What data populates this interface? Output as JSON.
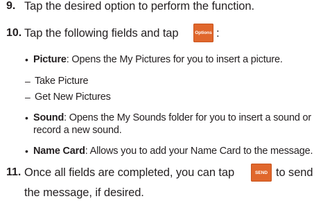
{
  "steps": {
    "s9": {
      "num": "9.",
      "text": "Tap the desired option to perform the function."
    },
    "s10": {
      "num": "10.",
      "text_before": "Tap the following fields and tap",
      "button_label": "Options",
      "text_after": ":",
      "items": [
        {
          "bullet": "•",
          "term": "Picture",
          "desc": ": Opens the My Pictures for you to insert a picture.",
          "subitems": [
            {
              "dash": "–",
              "text": "Take Picture"
            },
            {
              "dash": "–",
              "text": "Get New Pictures"
            }
          ]
        },
        {
          "bullet": "•",
          "term": "Sound",
          "desc_line1": ": Opens the My Sounds folder for you to insert a sound or",
          "desc_line2": "record a new sound."
        },
        {
          "bullet": "•",
          "term": "Name Card",
          "desc": ": Allows you to add your Name Card to the message."
        }
      ]
    },
    "s11": {
      "num": "11.",
      "text_before": "Once all fields are completed, you can tap",
      "button_label": "SEND",
      "text_after": "to send",
      "text_line2": "the message, if desired."
    }
  },
  "colors": {
    "text": "#231f20",
    "button_bg": "#e0672c",
    "button_text": "#ffffff"
  }
}
